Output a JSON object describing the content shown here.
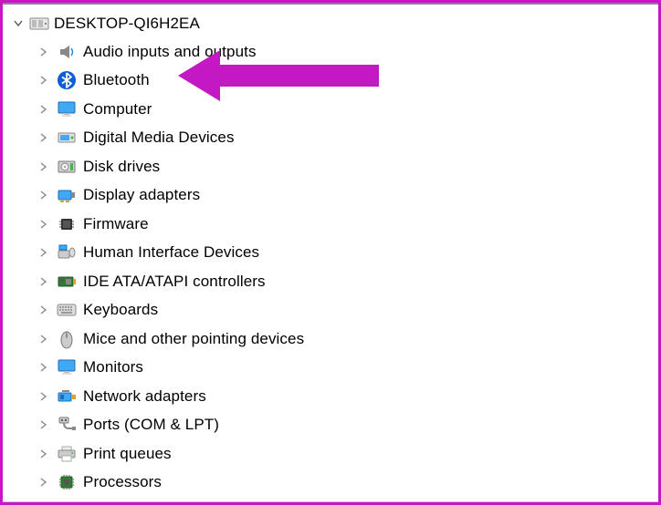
{
  "root": {
    "label": "DESKTOP-QI6H2EA"
  },
  "items": [
    {
      "label": "Audio inputs and outputs",
      "icon": "audio"
    },
    {
      "label": "Bluetooth",
      "icon": "bluetooth"
    },
    {
      "label": "Computer",
      "icon": "computer"
    },
    {
      "label": "Digital Media Devices",
      "icon": "digital-media"
    },
    {
      "label": "Disk drives",
      "icon": "disk"
    },
    {
      "label": "Display adapters",
      "icon": "display-adapter"
    },
    {
      "label": "Firmware",
      "icon": "firmware"
    },
    {
      "label": "Human Interface Devices",
      "icon": "hid"
    },
    {
      "label": "IDE ATA/ATAPI controllers",
      "icon": "ide"
    },
    {
      "label": "Keyboards",
      "icon": "keyboard"
    },
    {
      "label": "Mice and other pointing devices",
      "icon": "mouse"
    },
    {
      "label": "Monitors",
      "icon": "monitor"
    },
    {
      "label": "Network adapters",
      "icon": "network"
    },
    {
      "label": "Ports (COM & LPT)",
      "icon": "ports"
    },
    {
      "label": "Print queues",
      "icon": "printer"
    },
    {
      "label": "Processors",
      "icon": "processor"
    }
  ],
  "annotation": {
    "color": "#c318c3"
  }
}
